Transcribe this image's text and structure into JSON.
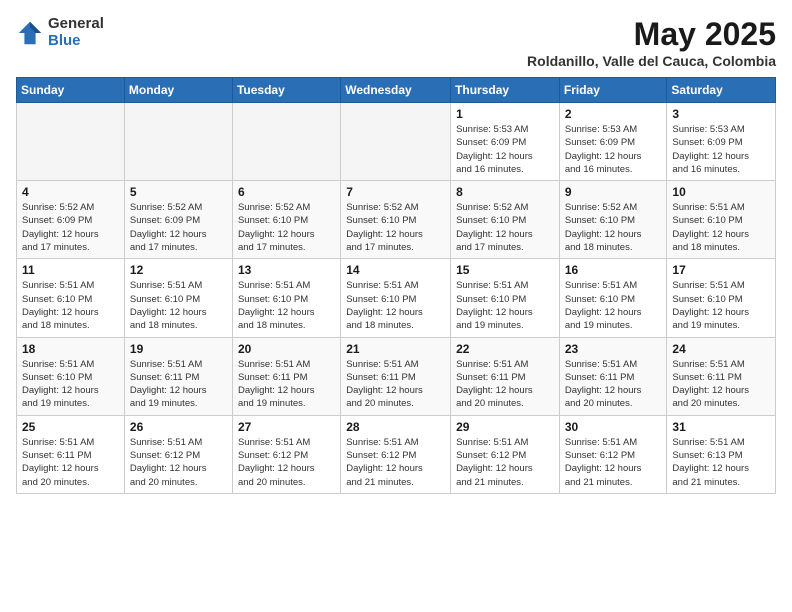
{
  "logo": {
    "general": "General",
    "blue": "Blue"
  },
  "title": {
    "month_year": "May 2025",
    "location": "Roldanillo, Valle del Cauca, Colombia"
  },
  "weekdays": [
    "Sunday",
    "Monday",
    "Tuesday",
    "Wednesday",
    "Thursday",
    "Friday",
    "Saturday"
  ],
  "weeks": [
    [
      {
        "day": "",
        "empty": true
      },
      {
        "day": "",
        "empty": true
      },
      {
        "day": "",
        "empty": true
      },
      {
        "day": "",
        "empty": true
      },
      {
        "day": "1",
        "text": "Sunrise: 5:53 AM\nSunset: 6:09 PM\nDaylight: 12 hours\nand 16 minutes."
      },
      {
        "day": "2",
        "text": "Sunrise: 5:53 AM\nSunset: 6:09 PM\nDaylight: 12 hours\nand 16 minutes."
      },
      {
        "day": "3",
        "text": "Sunrise: 5:53 AM\nSunset: 6:09 PM\nDaylight: 12 hours\nand 16 minutes."
      }
    ],
    [
      {
        "day": "4",
        "text": "Sunrise: 5:52 AM\nSunset: 6:09 PM\nDaylight: 12 hours\nand 17 minutes."
      },
      {
        "day": "5",
        "text": "Sunrise: 5:52 AM\nSunset: 6:09 PM\nDaylight: 12 hours\nand 17 minutes."
      },
      {
        "day": "6",
        "text": "Sunrise: 5:52 AM\nSunset: 6:10 PM\nDaylight: 12 hours\nand 17 minutes."
      },
      {
        "day": "7",
        "text": "Sunrise: 5:52 AM\nSunset: 6:10 PM\nDaylight: 12 hours\nand 17 minutes."
      },
      {
        "day": "8",
        "text": "Sunrise: 5:52 AM\nSunset: 6:10 PM\nDaylight: 12 hours\nand 17 minutes."
      },
      {
        "day": "9",
        "text": "Sunrise: 5:52 AM\nSunset: 6:10 PM\nDaylight: 12 hours\nand 18 minutes."
      },
      {
        "day": "10",
        "text": "Sunrise: 5:51 AM\nSunset: 6:10 PM\nDaylight: 12 hours\nand 18 minutes."
      }
    ],
    [
      {
        "day": "11",
        "text": "Sunrise: 5:51 AM\nSunset: 6:10 PM\nDaylight: 12 hours\nand 18 minutes."
      },
      {
        "day": "12",
        "text": "Sunrise: 5:51 AM\nSunset: 6:10 PM\nDaylight: 12 hours\nand 18 minutes."
      },
      {
        "day": "13",
        "text": "Sunrise: 5:51 AM\nSunset: 6:10 PM\nDaylight: 12 hours\nand 18 minutes."
      },
      {
        "day": "14",
        "text": "Sunrise: 5:51 AM\nSunset: 6:10 PM\nDaylight: 12 hours\nand 18 minutes."
      },
      {
        "day": "15",
        "text": "Sunrise: 5:51 AM\nSunset: 6:10 PM\nDaylight: 12 hours\nand 19 minutes."
      },
      {
        "day": "16",
        "text": "Sunrise: 5:51 AM\nSunset: 6:10 PM\nDaylight: 12 hours\nand 19 minutes."
      },
      {
        "day": "17",
        "text": "Sunrise: 5:51 AM\nSunset: 6:10 PM\nDaylight: 12 hours\nand 19 minutes."
      }
    ],
    [
      {
        "day": "18",
        "text": "Sunrise: 5:51 AM\nSunset: 6:10 PM\nDaylight: 12 hours\nand 19 minutes."
      },
      {
        "day": "19",
        "text": "Sunrise: 5:51 AM\nSunset: 6:11 PM\nDaylight: 12 hours\nand 19 minutes."
      },
      {
        "day": "20",
        "text": "Sunrise: 5:51 AM\nSunset: 6:11 PM\nDaylight: 12 hours\nand 19 minutes."
      },
      {
        "day": "21",
        "text": "Sunrise: 5:51 AM\nSunset: 6:11 PM\nDaylight: 12 hours\nand 20 minutes."
      },
      {
        "day": "22",
        "text": "Sunrise: 5:51 AM\nSunset: 6:11 PM\nDaylight: 12 hours\nand 20 minutes."
      },
      {
        "day": "23",
        "text": "Sunrise: 5:51 AM\nSunset: 6:11 PM\nDaylight: 12 hours\nand 20 minutes."
      },
      {
        "day": "24",
        "text": "Sunrise: 5:51 AM\nSunset: 6:11 PM\nDaylight: 12 hours\nand 20 minutes."
      }
    ],
    [
      {
        "day": "25",
        "text": "Sunrise: 5:51 AM\nSunset: 6:11 PM\nDaylight: 12 hours\nand 20 minutes."
      },
      {
        "day": "26",
        "text": "Sunrise: 5:51 AM\nSunset: 6:12 PM\nDaylight: 12 hours\nand 20 minutes."
      },
      {
        "day": "27",
        "text": "Sunrise: 5:51 AM\nSunset: 6:12 PM\nDaylight: 12 hours\nand 20 minutes."
      },
      {
        "day": "28",
        "text": "Sunrise: 5:51 AM\nSunset: 6:12 PM\nDaylight: 12 hours\nand 21 minutes."
      },
      {
        "day": "29",
        "text": "Sunrise: 5:51 AM\nSunset: 6:12 PM\nDaylight: 12 hours\nand 21 minutes."
      },
      {
        "day": "30",
        "text": "Sunrise: 5:51 AM\nSunset: 6:12 PM\nDaylight: 12 hours\nand 21 minutes."
      },
      {
        "day": "31",
        "text": "Sunrise: 5:51 AM\nSunset: 6:13 PM\nDaylight: 12 hours\nand 21 minutes."
      }
    ]
  ]
}
